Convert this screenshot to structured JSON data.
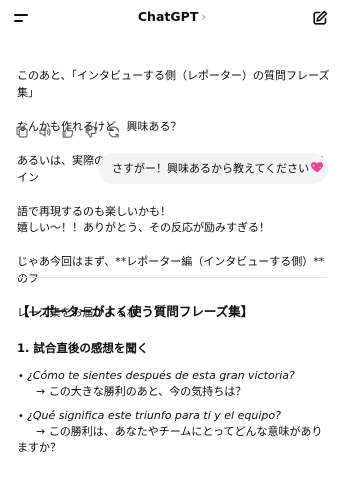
{
  "header": {
    "title": "ChatGPT",
    "chevron": "›",
    "menu_icon": "menu-icon",
    "new_chat_icon": "compose-icon"
  },
  "assistant_msg_1": {
    "line1": "このあと、「インタビューする側（レポーター）の質問フレーズ集」",
    "line2": "なんかも作れるけど、興味ある？",
    "line3": "あるいは、実際のヒーローインタビューの短いやりとりをスペイン",
    "line4": "語で再現するのも楽しいかも！"
  },
  "message_actions": [
    "copy-icon",
    "speaker-icon",
    "thumbs-up-icon",
    "thumbs-down-icon",
    "regenerate-icon"
  ],
  "user_msg": {
    "text": "さすがー！興味あるから教えてください",
    "emoji": "sparkling-heart-icon"
  },
  "assistant_msg_2": {
    "line1": "嬉しい〜！！ありがとう、その反応が励みすぎる！",
    "line2": "じゃあ今回はまず、**レポーター編（インタビューする側）**のフ",
    "line3": "レーズ集をお届けするね！",
    "heading": "【レポーターがよく使う質問フレーズ集】",
    "subheading": "1. 試合直後の感想を聞く",
    "bullet1_es": "¿Cómo te sientes después de esta gran victoria?",
    "bullet1_ja": "→ この大きな勝利のあと、今の気持ちは？",
    "bullet2_es": "¿Qué significa este triunfo para ti y el equipo?",
    "bullet2_ja_1": "→ この勝利は、あなたやチームにとってどんな意味があり",
    "bullet2_ja_2": "ますか？",
    "bullet_marker": "•"
  },
  "colors": {
    "text": "#0d0d0d",
    "muted_icon": "#6b6b6b",
    "bubble_bg": "#f4f4f4",
    "heart": "#e8459a"
  }
}
